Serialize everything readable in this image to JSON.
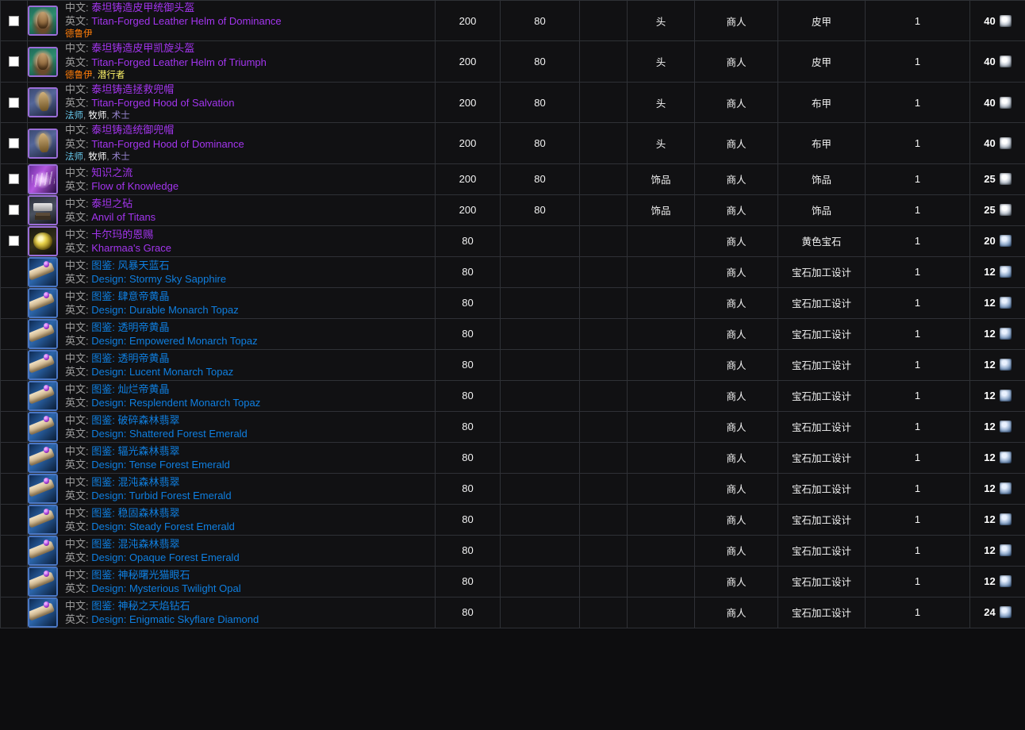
{
  "labels": {
    "cn": "中文:",
    "en": "英文:"
  },
  "colors": {
    "epic": "#a335ee",
    "rare": "#0f7fe0",
    "druid": "#ff7d0a",
    "rogue": "#fff569",
    "mage": "#69ccf0",
    "priest": "#ffffff",
    "warlock": "#9482c9",
    "grid": "#2f3136",
    "background": "#111113"
  },
  "rows": [
    {
      "checkbox": true,
      "icon": "helm-leather-icon",
      "quality": "epic",
      "name_cn": "泰坦铸造皮甲统御头盔",
      "name_en": "Titan-Forged Leather Helm of Dominance",
      "classes": [
        {
          "label": "德鲁伊",
          "cls": "druid"
        }
      ],
      "ilvl": "200",
      "req_level": "80",
      "extra": "",
      "slot": "头",
      "source": "商人",
      "type": "皮甲",
      "qty": "1",
      "cost": "40",
      "currency": "emblem-icon"
    },
    {
      "checkbox": true,
      "icon": "helm-leather-icon",
      "quality": "epic",
      "name_cn": "泰坦铸造皮甲凯旋头盔",
      "name_en": "Titan-Forged Leather Helm of Triumph",
      "classes": [
        {
          "label": "德鲁伊",
          "cls": "druid"
        },
        {
          "label": "潜行者",
          "cls": "rogue"
        }
      ],
      "ilvl": "200",
      "req_level": "80",
      "extra": "",
      "slot": "头",
      "source": "商人",
      "type": "皮甲",
      "qty": "1",
      "cost": "40",
      "currency": "emblem-icon"
    },
    {
      "checkbox": true,
      "icon": "hood-cloth-icon",
      "quality": "epic",
      "name_cn": "泰坦铸造拯救兜帽",
      "name_en": "Titan-Forged Hood of Salvation",
      "classes": [
        {
          "label": "法师",
          "cls": "mage"
        },
        {
          "label": "牧师",
          "cls": "priest"
        },
        {
          "label": "术士",
          "cls": "warlock"
        }
      ],
      "ilvl": "200",
      "req_level": "80",
      "extra": "",
      "slot": "头",
      "source": "商人",
      "type": "布甲",
      "qty": "1",
      "cost": "40",
      "currency": "emblem-icon"
    },
    {
      "checkbox": true,
      "icon": "hood-cloth-icon",
      "quality": "epic",
      "name_cn": "泰坦铸造统御兜帽",
      "name_en": "Titan-Forged Hood of Dominance",
      "classes": [
        {
          "label": "法师",
          "cls": "mage"
        },
        {
          "label": "牧师",
          "cls": "priest"
        },
        {
          "label": "术士",
          "cls": "warlock"
        }
      ],
      "ilvl": "200",
      "req_level": "80",
      "extra": "",
      "slot": "头",
      "source": "商人",
      "type": "布甲",
      "qty": "1",
      "cost": "40",
      "currency": "emblem-icon"
    },
    {
      "checkbox": true,
      "icon": "book-purple-icon",
      "quality": "epic",
      "name_cn": "知识之流",
      "name_en": "Flow of Knowledge",
      "classes": [],
      "ilvl": "200",
      "req_level": "80",
      "extra": "",
      "slot": "饰品",
      "source": "商人",
      "type": "饰品",
      "qty": "1",
      "cost": "25",
      "currency": "emblem-icon"
    },
    {
      "checkbox": true,
      "icon": "anvil-icon",
      "quality": "epic",
      "name_cn": "泰坦之砧",
      "name_en": "Anvil of Titans",
      "classes": [],
      "ilvl": "200",
      "req_level": "80",
      "extra": "",
      "slot": "饰品",
      "source": "商人",
      "type": "饰品",
      "qty": "1",
      "cost": "25",
      "currency": "emblem-icon"
    },
    {
      "checkbox": true,
      "icon": "gem-yellow-icon",
      "quality": "epic",
      "name_cn": "卡尔玛的恩赐",
      "name_en": "Kharmaa's Grace",
      "classes": [],
      "ilvl": "80",
      "req_level": "",
      "extra": "",
      "slot": "",
      "source": "商人",
      "type": "黄色宝石",
      "qty": "1",
      "cost": "20",
      "currency": "badge-icon"
    },
    {
      "checkbox": false,
      "icon": "design-scroll-icon",
      "quality": "rare",
      "name_cn": "图鉴: 风暴天蓝石",
      "name_en": "Design: Stormy Sky Sapphire",
      "classes": [],
      "ilvl": "80",
      "req_level": "",
      "extra": "",
      "slot": "",
      "source": "商人",
      "type": "宝石加工设计",
      "qty": "1",
      "cost": "12",
      "currency": "badge-icon"
    },
    {
      "checkbox": false,
      "icon": "design-scroll-icon",
      "quality": "rare",
      "name_cn": "图鉴: 肆意帝黄晶",
      "name_en": "Design: Durable Monarch Topaz",
      "classes": [],
      "ilvl": "80",
      "req_level": "",
      "extra": "",
      "slot": "",
      "source": "商人",
      "type": "宝石加工设计",
      "qty": "1",
      "cost": "12",
      "currency": "badge-icon"
    },
    {
      "checkbox": false,
      "icon": "design-scroll-icon",
      "quality": "rare",
      "name_cn": "图鉴: 透明帝黄晶",
      "name_en": "Design: Empowered Monarch Topaz",
      "classes": [],
      "ilvl": "80",
      "req_level": "",
      "extra": "",
      "slot": "",
      "source": "商人",
      "type": "宝石加工设计",
      "qty": "1",
      "cost": "12",
      "currency": "badge-icon"
    },
    {
      "checkbox": false,
      "icon": "design-scroll-icon",
      "quality": "rare",
      "name_cn": "图鉴: 透明帝黄晶",
      "name_en": "Design: Lucent Monarch Topaz",
      "classes": [],
      "ilvl": "80",
      "req_level": "",
      "extra": "",
      "slot": "",
      "source": "商人",
      "type": "宝石加工设计",
      "qty": "1",
      "cost": "12",
      "currency": "badge-icon"
    },
    {
      "checkbox": false,
      "icon": "design-scroll-icon",
      "quality": "rare",
      "name_cn": "图鉴: 灿烂帝黄晶",
      "name_en": "Design: Resplendent Monarch Topaz",
      "classes": [],
      "ilvl": "80",
      "req_level": "",
      "extra": "",
      "slot": "",
      "source": "商人",
      "type": "宝石加工设计",
      "qty": "1",
      "cost": "12",
      "currency": "badge-icon"
    },
    {
      "checkbox": false,
      "icon": "design-scroll-icon",
      "quality": "rare",
      "name_cn": "图鉴: 破碎森林翡翠",
      "name_en": "Design: Shattered Forest Emerald",
      "classes": [],
      "ilvl": "80",
      "req_level": "",
      "extra": "",
      "slot": "",
      "source": "商人",
      "type": "宝石加工设计",
      "qty": "1",
      "cost": "12",
      "currency": "badge-icon"
    },
    {
      "checkbox": false,
      "icon": "design-scroll-icon",
      "quality": "rare",
      "name_cn": "图鉴: 辐光森林翡翠",
      "name_en": "Design: Tense Forest Emerald",
      "classes": [],
      "ilvl": "80",
      "req_level": "",
      "extra": "",
      "slot": "",
      "source": "商人",
      "type": "宝石加工设计",
      "qty": "1",
      "cost": "12",
      "currency": "badge-icon"
    },
    {
      "checkbox": false,
      "icon": "design-scroll-icon",
      "quality": "rare",
      "name_cn": "图鉴: 混沌森林翡翠",
      "name_en": "Design: Turbid Forest Emerald",
      "classes": [],
      "ilvl": "80",
      "req_level": "",
      "extra": "",
      "slot": "",
      "source": "商人",
      "type": "宝石加工设计",
      "qty": "1",
      "cost": "12",
      "currency": "badge-icon"
    },
    {
      "checkbox": false,
      "icon": "design-scroll-icon",
      "quality": "rare",
      "name_cn": "图鉴: 稳固森林翡翠",
      "name_en": "Design: Steady Forest Emerald",
      "classes": [],
      "ilvl": "80",
      "req_level": "",
      "extra": "",
      "slot": "",
      "source": "商人",
      "type": "宝石加工设计",
      "qty": "1",
      "cost": "12",
      "currency": "badge-icon"
    },
    {
      "checkbox": false,
      "icon": "design-scroll-icon",
      "quality": "rare",
      "name_cn": "图鉴: 混沌森林翡翠",
      "name_en": "Design: Opaque Forest Emerald",
      "classes": [],
      "ilvl": "80",
      "req_level": "",
      "extra": "",
      "slot": "",
      "source": "商人",
      "type": "宝石加工设计",
      "qty": "1",
      "cost": "12",
      "currency": "badge-icon"
    },
    {
      "checkbox": false,
      "icon": "design-scroll-icon",
      "quality": "rare",
      "name_cn": "图鉴: 神秘曙光猫眼石",
      "name_en": "Design: Mysterious Twilight Opal",
      "classes": [],
      "ilvl": "80",
      "req_level": "",
      "extra": "",
      "slot": "",
      "source": "商人",
      "type": "宝石加工设计",
      "qty": "1",
      "cost": "12",
      "currency": "badge-icon"
    },
    {
      "checkbox": false,
      "icon": "design-scroll-icon",
      "quality": "rare",
      "name_cn": "图鉴: 神秘之天焰钻石",
      "name_en": "Design: Enigmatic Skyflare Diamond",
      "classes": [],
      "ilvl": "80",
      "req_level": "",
      "extra": "",
      "slot": "",
      "source": "商人",
      "type": "宝石加工设计",
      "qty": "1",
      "cost": "24",
      "currency": "badge-icon"
    }
  ]
}
